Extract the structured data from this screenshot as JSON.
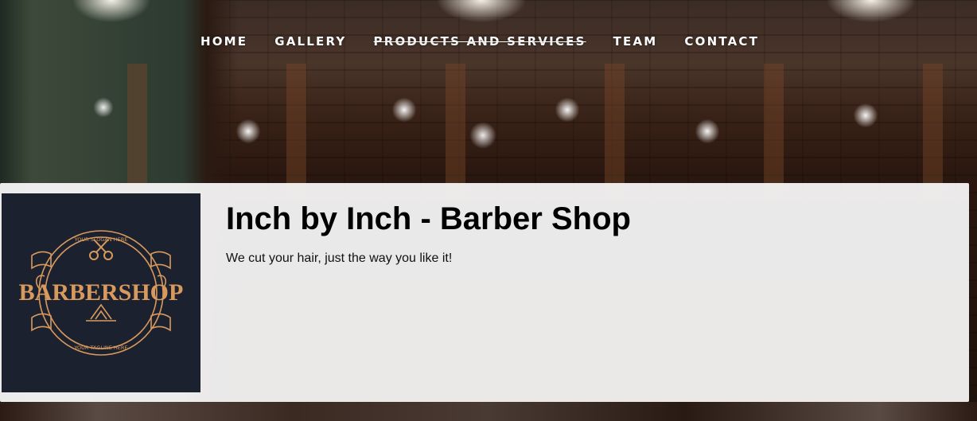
{
  "nav": {
    "items": [
      {
        "label": "HOME"
      },
      {
        "label": "GALLERY"
      },
      {
        "label": "PRODUCTS AND SERVICES",
        "active": true
      },
      {
        "label": "TEAM"
      },
      {
        "label": "CONTACT"
      }
    ]
  },
  "header": {
    "title": "Inch by Inch - Barber Shop",
    "tagline": "We cut your hair, just the way you like it!"
  },
  "logo": {
    "wordmark": "BARBERSHOP",
    "slogan": "YOUR SLOGAN HERE",
    "tagline": "YOUR TAGLINE HERE",
    "icon": "scissors-icon",
    "background_color": "#1c2130",
    "accent_color": "#d89a5c"
  },
  "colors": {
    "panel": "#fafafa",
    "nav_text": "#ffffff",
    "title_text": "#000000"
  }
}
